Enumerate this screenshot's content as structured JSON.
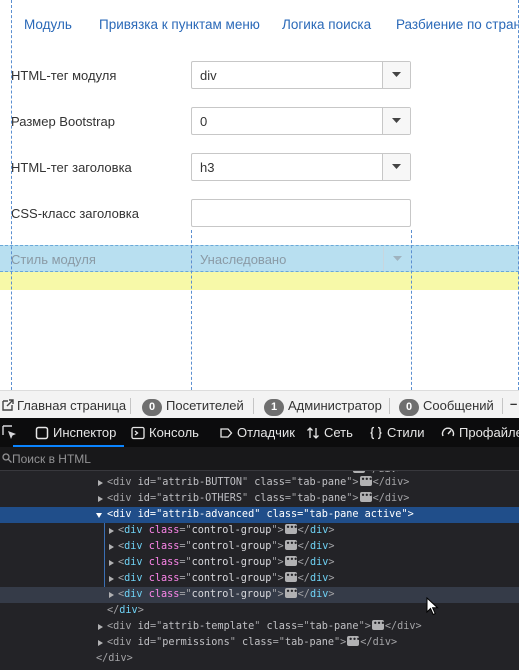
{
  "tabs": [
    {
      "label": "Модуль"
    },
    {
      "label": "Привязка к пунктам меню"
    },
    {
      "label": "Логика поиска"
    },
    {
      "label": "Разбиение по страни"
    }
  ],
  "form": {
    "module_tag": {
      "label": "HTML-тег модуля",
      "value": "div"
    },
    "bootstrap_size": {
      "label": "Размер Bootstrap",
      "value": "0"
    },
    "header_tag": {
      "label": "HTML-тег заголовка",
      "value": "h3"
    },
    "header_class": {
      "label": "CSS-класс заголовка",
      "value": ""
    },
    "module_style": {
      "label": "Стиль модуля",
      "value": "Унаследовано"
    }
  },
  "statusbar": {
    "home": "Главная страница",
    "visitors_count": "0",
    "visitors_label": "Посетителей",
    "admins_count": "1",
    "admins_label": "Администратор",
    "messages_count": "0",
    "messages_label": "Сообщений"
  },
  "devtools": {
    "tabs": {
      "inspector": "Инспектор",
      "console": "Консоль",
      "debugger": "Отладчик",
      "network": "Сеть",
      "styles": "Стили",
      "profiler": "Профайле"
    },
    "search_placeholder": "Поиск в HTML",
    "markup": {
      "r1_id": "attrib-BUTTON",
      "r2_id": "attrib-OTHERS",
      "r3_id": "attrib-advanced",
      "r3_class": "tab-pane active",
      "child_class": "control-group",
      "pane_class": "tab-pane",
      "r9_id": "attrib-template",
      "r10_id": "permissions"
    }
  },
  "colors": {
    "link": "#2a69b8",
    "highlight_blue": "#b8dff0",
    "highlight_yellow": "#f7f9a8",
    "devtools_bg": "#232327",
    "selection": "#204e8a"
  }
}
